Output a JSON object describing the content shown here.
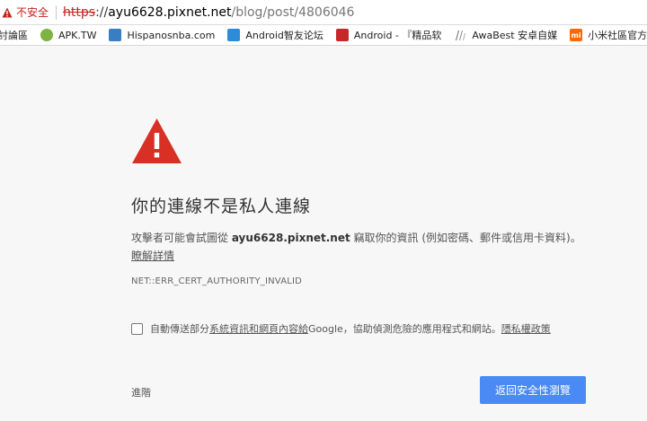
{
  "addressbar": {
    "insecure_label": "不安全",
    "url_scheme": "https",
    "url_rest": "://",
    "url_host": "ayu6628.pixnet.net",
    "url_path": "/blog/post/4806046"
  },
  "bookmarks": [
    {
      "label": "討論區",
      "icon": "forum-icon",
      "color": "#5b9bd5"
    },
    {
      "label": "APK.TW",
      "icon": "apk-tw-icon",
      "color": "#7cb342"
    },
    {
      "label": "Hispanosnba.com",
      "icon": "hispanosnba-icon",
      "color": "#3a7ec2"
    },
    {
      "label": "Android智友论坛",
      "icon": "android-forum-icon",
      "color": "#2e8bd8"
    },
    {
      "label": "Android - 『精品软",
      "icon": "android-app-icon",
      "color": "#c62828"
    },
    {
      "label": "AwaBest 安卓自媒",
      "icon": "awabest-icon",
      "color": "#555555"
    },
    {
      "label": "小米社區官方論壇",
      "icon": "mi-icon",
      "color": "#ff6700"
    },
    {
      "label": "",
      "icon": "extra-bookmark-icon",
      "color": "#1e3f8a"
    }
  ],
  "main": {
    "heading": "你的連線不是私人連線",
    "desc_before": "攻擊者可能會試圖從 ",
    "desc_host": "ayu6628.pixnet.net",
    "desc_after": " 竊取你的資訊 (例如密碼、郵件或信用卡資料)。",
    "learn_more": "瞭解詳情",
    "error_code": "NET::ERR_CERT_AUTHORITY_INVALID",
    "checkbox_before": "自動傳送部分",
    "checkbox_link": "系統資訊和網頁內容給",
    "checkbox_after": " Google，協助偵測危險的應用程式和網站。",
    "privacy_link": "隱私權政策",
    "advanced": "進階",
    "back_button": "返回安全性瀏覽"
  },
  "colors": {
    "warning_red": "#d93025",
    "button_blue": "#4a8af4",
    "page_bg": "#f7f7f7"
  }
}
